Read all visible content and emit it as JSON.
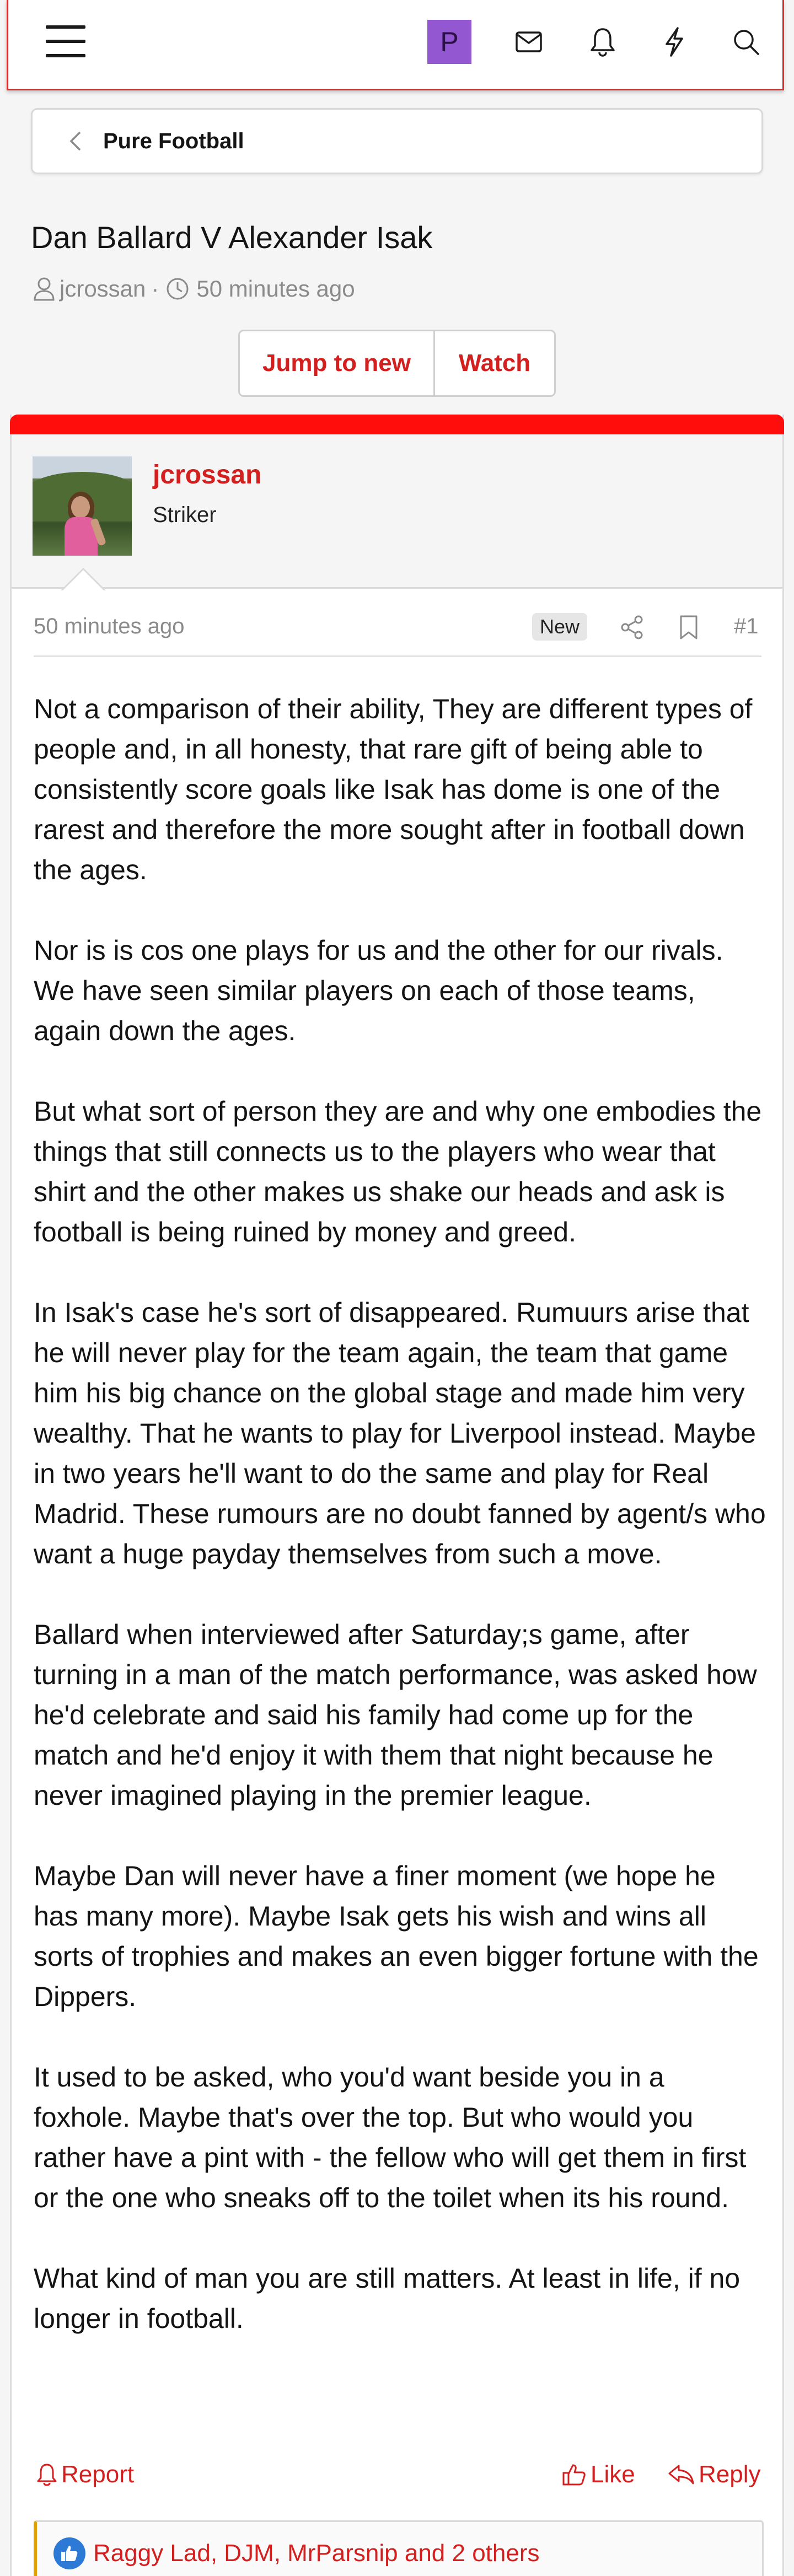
{
  "topbar": {
    "menu_icon": "hamburger-icon",
    "avatar_letter": "P",
    "avatar_color": "#9457d2",
    "icons": [
      "mail-icon",
      "bell-icon",
      "lightning-icon",
      "search-icon"
    ]
  },
  "breadcrumb": {
    "back_icon": "chevron-left-icon",
    "forum": "Pure Football"
  },
  "thread": {
    "title": "Dan Ballard V Alexander Isak",
    "author": "jcrossan",
    "separator": "·",
    "time": "50 minutes ago",
    "jump_label": "Jump to new",
    "watch_label": "Watch"
  },
  "post": {
    "accent_color": "#ff0d0d",
    "username": "jcrossan",
    "user_title": "Striker",
    "date": "50 minutes ago",
    "badge": "New",
    "number": "#1",
    "paragraphs": [
      "Not a comparison of their ability, They are different types of people and, in all honesty, that rare gift of being able to consistently score goals like Isak has dome is one of the rarest and therefore the more sought after in football down the ages.",
      "Nor is is cos one plays for us and the other for our rivals. We have seen similar players on each of those teams, again down the ages.",
      "But what sort of person they are and why one embodies the things that still connects us to the players who wear that shirt and the other makes us shake our heads and ask is football is being ruined by money and greed.",
      "In Isak's case he's sort of disappeared. Rumuurs arise that he will never play for the team again, the team that game him his big chance on the global stage and made him very wealthy. That he wants to play for Liverpool instead. Maybe in two years he'll want to do the same and play for Real Madrid. These rumours are no doubt fanned by agent/s who want a huge payday themselves from such a move.",
      "Ballard when interviewed after Saturday;s game, after turning in a man of the match performance, was asked how he'd celebrate and said his family had come up for the match and he'd enjoy it with them that night because he never imagined playing in the premier league.",
      "Maybe Dan will never have a finer moment (we hope he has many more). Maybe Isak gets his wish and wins all sorts of trophies and makes an even bigger fortune with the Dippers.",
      "It used to be asked, who you'd want beside you in a foxhole. Maybe that's over the top. But who would you rather have a pint with - the fellow who will get them in first or the one who sneaks off to the toilet when its his round.",
      "What kind of man you are still matters. At least in life, if no longer in football."
    ],
    "actions": {
      "report": "Report",
      "like": "Like",
      "reply": "Reply"
    },
    "reactions": "Raggy Lad, DJM, MrParsnip and 2 others"
  }
}
